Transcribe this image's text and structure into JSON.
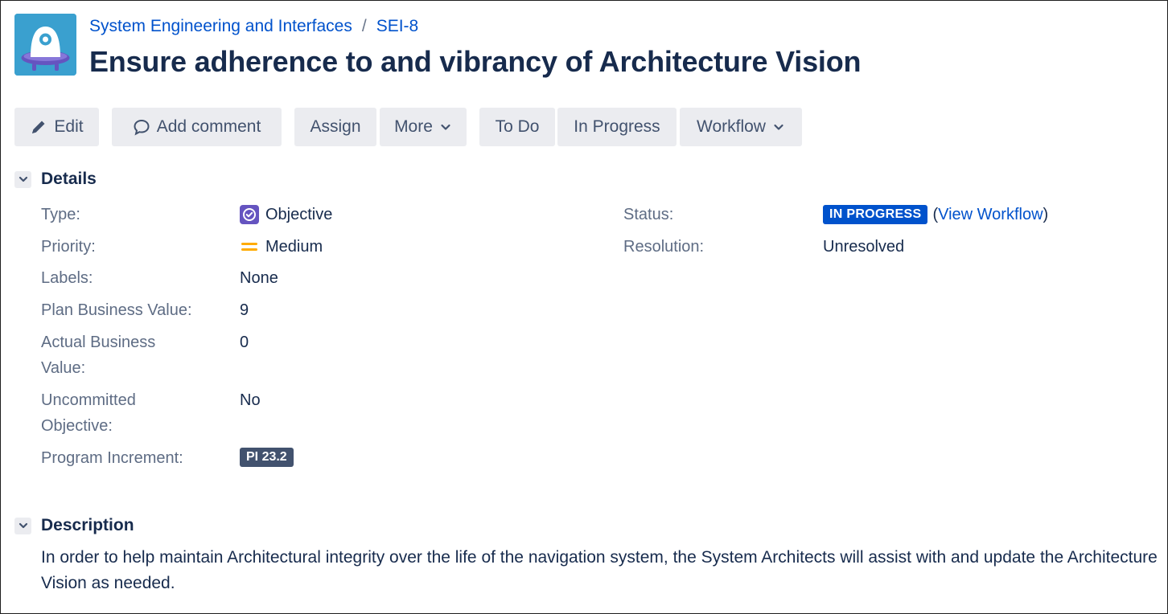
{
  "header": {
    "project_name": "System Engineering and Interfaces",
    "breadcrumb_separator": "/",
    "issue_key": "SEI-8",
    "title": "Ensure adherence to and vibrancy of Architecture Vision",
    "avatar_icon": "ufo-robot-avatar-icon"
  },
  "toolbar": {
    "edit_label": "Edit",
    "add_comment_label": "Add comment",
    "assign_label": "Assign",
    "more_label": "More",
    "todo_label": "To Do",
    "in_progress_label": "In Progress",
    "workflow_label": "Workflow"
  },
  "details": {
    "section_title": "Details",
    "type": {
      "label": "Type:",
      "value": "Objective",
      "icon": "objective-check-icon"
    },
    "priority": {
      "label": "Priority:",
      "value": "Medium",
      "icon": "priority-medium-icon"
    },
    "labels": {
      "label": "Labels:",
      "value": "None"
    },
    "plan_business_value": {
      "label": "Plan Business Value:",
      "value": "9"
    },
    "actual_business_value": {
      "label": "Actual Business Value:",
      "value": "0"
    },
    "uncommitted_objective": {
      "label": "Uncommitted Objective:",
      "value": "No"
    },
    "program_increment": {
      "label": "Program Increment:",
      "value": "PI 23.2"
    },
    "status": {
      "label": "Status:",
      "value": "IN PROGRESS",
      "link": "View Workflow",
      "open_paren": "(",
      "close_paren": ")"
    },
    "resolution": {
      "label": "Resolution:",
      "value": "Unresolved"
    }
  },
  "description": {
    "section_title": "Description",
    "text": "In order to help maintain Architectural integrity over the life of the navigation system, the System Architects will assist with and update the Architecture Vision as needed."
  },
  "colors": {
    "link": "#0052cc",
    "text": "#172b4d",
    "label": "#5e6c84",
    "button_bg": "#ebecf0",
    "status_lozenge": "#0052cc",
    "objective_icon": "#6554c0",
    "priority_medium": "#ffab00"
  }
}
